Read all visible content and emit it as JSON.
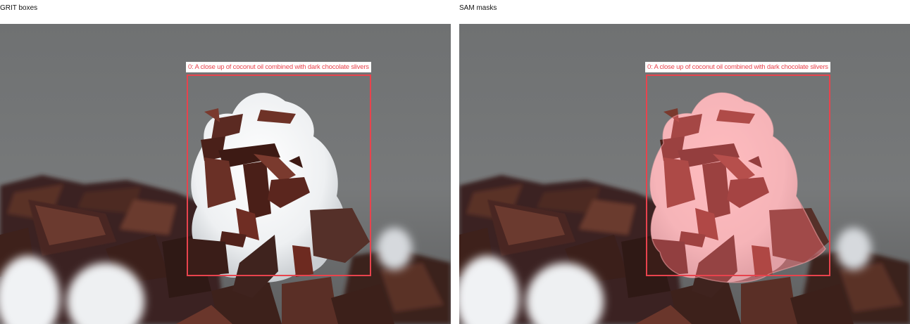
{
  "panels": {
    "left": {
      "title": "GRIT boxes"
    },
    "right": {
      "title": "SAM masks"
    }
  },
  "annotation": {
    "label": "0: A close up of coconut oil combined with dark chocolate slivers",
    "box_color": "#e8434d",
    "mask_color": "#ff6b72"
  },
  "photo": {
    "subject": "coconut oil with dark chocolate slivers",
    "background_color": "#707273"
  }
}
